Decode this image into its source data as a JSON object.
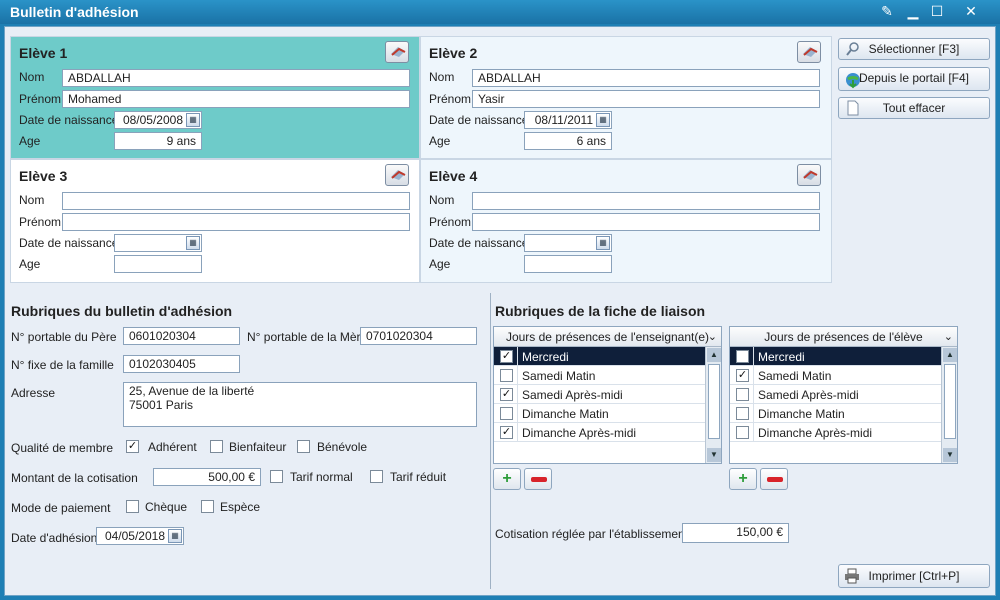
{
  "window": {
    "title": "Bulletin d'adhésion"
  },
  "students": [
    {
      "heading": "Elève 1",
      "nom_label": "Nom",
      "nom": "ABDALLAH",
      "prenom_label": "Prénom",
      "prenom": "Mohamed",
      "dob_label": "Date de naissance",
      "dob": "08/05/2008",
      "age_label": "Age",
      "age": "9 ans"
    },
    {
      "heading": "Elève 2",
      "nom_label": "Nom",
      "nom": "ABDALLAH",
      "prenom_label": "Prénom",
      "prenom": "Yasir",
      "dob_label": "Date de naissance",
      "dob": "08/11/2011",
      "age_label": "Age",
      "age": "6 ans"
    },
    {
      "heading": "Elève 3",
      "nom_label": "Nom",
      "nom": "",
      "prenom_label": "Prénom",
      "prenom": "",
      "dob_label": "Date de naissance",
      "dob": "",
      "age_label": "Age",
      "age": ""
    },
    {
      "heading": "Elève 4",
      "nom_label": "Nom",
      "nom": "",
      "prenom_label": "Prénom",
      "prenom": "",
      "dob_label": "Date de naissance",
      "dob": "",
      "age_label": "Age",
      "age": ""
    }
  ],
  "side": {
    "select": "Sélectionner [F3]",
    "portal": "Depuis le portail [F4]",
    "clear": "Tout effacer"
  },
  "rubriques": {
    "title": "Rubriques du bulletin d'adhésion",
    "pere_label": "N° portable du Père",
    "pere": "0601020304",
    "mere_label": "N° portable de la Mère",
    "mere": "0701020304",
    "fixe_label": "N° fixe de la famille",
    "fixe": "0102030405",
    "adresse_label": "Adresse",
    "adresse_line1": "25, Avenue de la liberté",
    "adresse_line2": "75001 Paris",
    "qualite_label": "Qualité de membre",
    "adherent": "Adhérent",
    "bienfaiteur": "Bienfaiteur",
    "benevole": "Bénévole",
    "montant_label": "Montant de la cotisation",
    "montant": "500,00 €",
    "tarif_normal": "Tarif normal",
    "tarif_reduit": "Tarif réduit",
    "mode_label": "Mode de paiement",
    "cheque": "Chèque",
    "espece": "Espèce",
    "date_label": "Date d'adhésion",
    "date": "04/05/2018"
  },
  "liaison": {
    "title": "Rubriques de la fiche de liaison",
    "grid1": {
      "header": "Jours de présences de l'enseignant(e)",
      "rows": [
        {
          "label": "Mercredi",
          "checked": true,
          "selected": true
        },
        {
          "label": "Samedi Matin",
          "checked": false
        },
        {
          "label": "Samedi Après-midi",
          "checked": true
        },
        {
          "label": "Dimanche Matin",
          "checked": false
        },
        {
          "label": "Dimanche Après-midi",
          "checked": true
        }
      ]
    },
    "grid2": {
      "header": "Jours de présences de l'élève",
      "rows": [
        {
          "label": "Mercredi",
          "checked": false,
          "selected": true
        },
        {
          "label": "Samedi Matin",
          "checked": true
        },
        {
          "label": "Samedi Après-midi",
          "checked": false
        },
        {
          "label": "Dimanche Matin",
          "checked": false
        },
        {
          "label": "Dimanche Après-midi",
          "checked": false
        }
      ]
    },
    "cotisation_label": "Cotisation réglée par l'établissement",
    "cotisation": "150,00 €"
  },
  "print_label": "Imprimer [Ctrl+P]",
  "colors": {
    "selected_card": "#6ecbc9",
    "card_bg": "#eef6fc",
    "titlebar": "#1e7fb4"
  }
}
